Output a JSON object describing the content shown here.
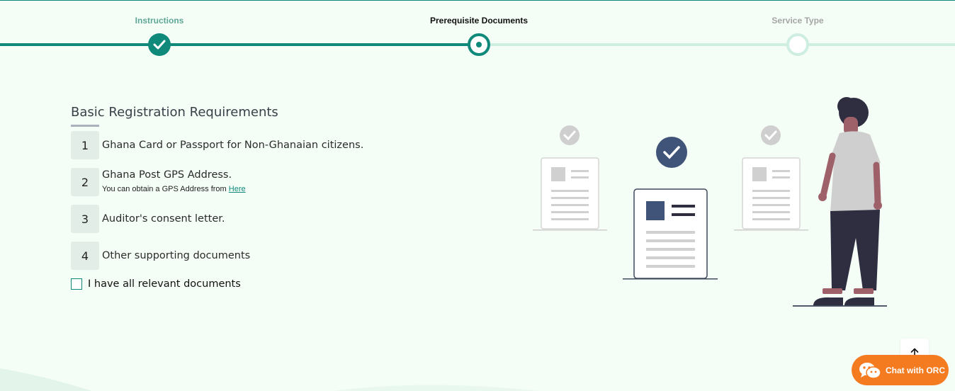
{
  "stepper": {
    "steps": [
      {
        "label": "Instructions",
        "state": "done"
      },
      {
        "label": "Prerequisite Documents",
        "state": "active"
      },
      {
        "label": "Service Type",
        "state": "todo"
      }
    ]
  },
  "requirements": {
    "title": "Basic Registration Requirements",
    "items": [
      {
        "number": "1",
        "text": "Ghana Card or Passport for Non-Ghanaian citizens."
      },
      {
        "number": "2",
        "text": "Ghana Post GPS Address.",
        "sub_text": "You can obtain a GPS Address from ",
        "sub_link": "Here"
      },
      {
        "number": "3",
        "text": "Auditor's consent letter."
      },
      {
        "number": "4",
        "text": "Other supporting documents"
      }
    ],
    "confirm_label": "I have all relevant documents",
    "confirm_checked": false
  },
  "chat": {
    "label": "Chat with ORC"
  },
  "colors": {
    "primary": "#0f8a7a",
    "track_todo": "#cdeee0",
    "chat": "#f47b20",
    "background": "#f5fdf7"
  },
  "icons": {
    "scroll_top": "arrow-up-icon",
    "chat": "wechat-icon",
    "step_done": "check-icon"
  }
}
